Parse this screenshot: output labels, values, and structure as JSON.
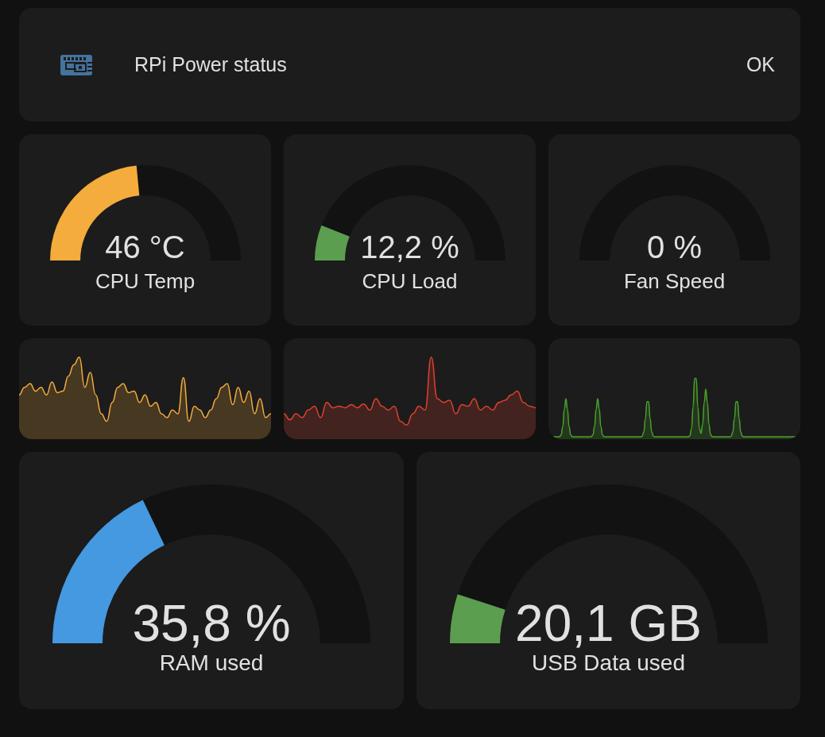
{
  "power_status": {
    "label": "RPi Power status",
    "value": "OK"
  },
  "gauges": [
    {
      "value": "46 °C",
      "label": "CPU Temp",
      "level": 0.47,
      "color": "#f4ac3d",
      "kind": "small"
    },
    {
      "value": "12,2 %",
      "label": "CPU Load",
      "level": 0.12,
      "color": "#5c9e4f",
      "kind": "small"
    },
    {
      "value": "0 %",
      "label": "Fan Speed",
      "kind": "small"
    }
  ],
  "sparklines": [
    {
      "color": "#f4ac3d"
    },
    {
      "color": "#e0412f"
    },
    {
      "color": "#4aa12c"
    }
  ],
  "large_gauges": [
    {
      "value": "35,8 %",
      "label": "RAM used",
      "level": 0.358,
      "color": "#4499e0",
      "kind": "large"
    },
    {
      "value": "20,1 GB",
      "label": "USB Data used",
      "level": 0.1,
      "color": "#5c9e4f",
      "kind": "large"
    }
  ]
}
